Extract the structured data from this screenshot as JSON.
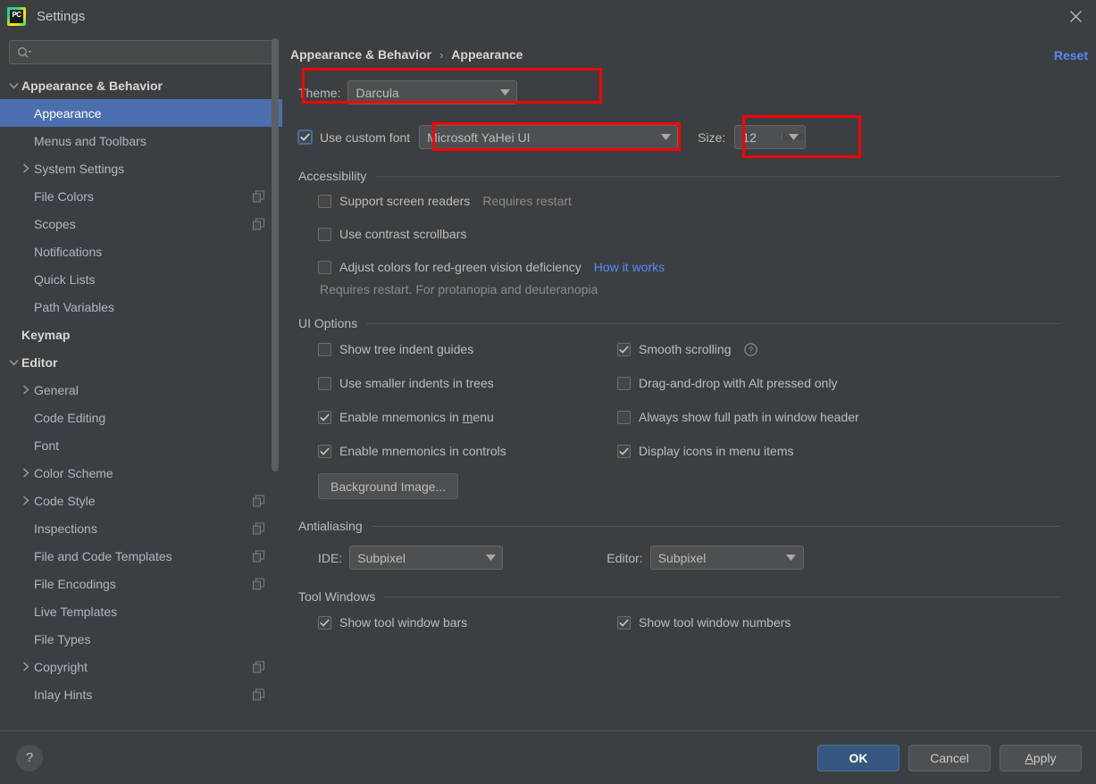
{
  "window": {
    "title": "Settings",
    "logo_text": "PC",
    "logo_icon": "pycharm-logo-icon",
    "close_icon": "close-icon"
  },
  "sidebar": {
    "search": {
      "placeholder": "",
      "value": "",
      "icon": "search-icon"
    },
    "tree": [
      {
        "label": "Appearance & Behavior",
        "level": 0,
        "twisty": "expanded",
        "bold": true,
        "selected": false,
        "badge": false
      },
      {
        "label": "Appearance",
        "level": 1,
        "twisty": "none",
        "bold": false,
        "selected": true,
        "badge": false
      },
      {
        "label": "Menus and Toolbars",
        "level": 1,
        "twisty": "none",
        "bold": false,
        "selected": false,
        "badge": false
      },
      {
        "label": "System Settings",
        "level": 1,
        "twisty": "collapsed",
        "bold": false,
        "selected": false,
        "badge": false
      },
      {
        "label": "File Colors",
        "level": 1,
        "twisty": "none",
        "bold": false,
        "selected": false,
        "badge": true
      },
      {
        "label": "Scopes",
        "level": 1,
        "twisty": "none",
        "bold": false,
        "selected": false,
        "badge": true
      },
      {
        "label": "Notifications",
        "level": 1,
        "twisty": "none",
        "bold": false,
        "selected": false,
        "badge": false
      },
      {
        "label": "Quick Lists",
        "level": 1,
        "twisty": "none",
        "bold": false,
        "selected": false,
        "badge": false
      },
      {
        "label": "Path Variables",
        "level": 1,
        "twisty": "none",
        "bold": false,
        "selected": false,
        "badge": false
      },
      {
        "label": "Keymap",
        "level": 0,
        "twisty": "none",
        "bold": true,
        "selected": false,
        "badge": false
      },
      {
        "label": "Editor",
        "level": 0,
        "twisty": "expanded",
        "bold": true,
        "selected": false,
        "badge": false
      },
      {
        "label": "General",
        "level": 1,
        "twisty": "collapsed",
        "bold": false,
        "selected": false,
        "badge": false
      },
      {
        "label": "Code Editing",
        "level": 1,
        "twisty": "none",
        "bold": false,
        "selected": false,
        "badge": false
      },
      {
        "label": "Font",
        "level": 1,
        "twisty": "none",
        "bold": false,
        "selected": false,
        "badge": false
      },
      {
        "label": "Color Scheme",
        "level": 1,
        "twisty": "collapsed",
        "bold": false,
        "selected": false,
        "badge": false
      },
      {
        "label": "Code Style",
        "level": 1,
        "twisty": "collapsed",
        "bold": false,
        "selected": false,
        "badge": true
      },
      {
        "label": "Inspections",
        "level": 1,
        "twisty": "none",
        "bold": false,
        "selected": false,
        "badge": true
      },
      {
        "label": "File and Code Templates",
        "level": 1,
        "twisty": "none",
        "bold": false,
        "selected": false,
        "badge": true
      },
      {
        "label": "File Encodings",
        "level": 1,
        "twisty": "none",
        "bold": false,
        "selected": false,
        "badge": true
      },
      {
        "label": "Live Templates",
        "level": 1,
        "twisty": "none",
        "bold": false,
        "selected": false,
        "badge": false
      },
      {
        "label": "File Types",
        "level": 1,
        "twisty": "none",
        "bold": false,
        "selected": false,
        "badge": false
      },
      {
        "label": "Copyright",
        "level": 1,
        "twisty": "collapsed",
        "bold": false,
        "selected": false,
        "badge": true
      },
      {
        "label": "Inlay Hints",
        "level": 1,
        "twisty": "none",
        "bold": false,
        "selected": false,
        "badge": true
      }
    ]
  },
  "main": {
    "breadcrumb": {
      "parent": "Appearance & Behavior",
      "separator": "›",
      "current": "Appearance"
    },
    "reset_label": "Reset",
    "theme": {
      "label": "Theme:",
      "value": "Darcula"
    },
    "custom_font": {
      "checkbox_label": "Use custom font",
      "checked": true,
      "font_value": "Microsoft YaHei UI",
      "size_label": "Size:",
      "size_value": "12"
    },
    "accessibility": {
      "title": "Accessibility",
      "options": [
        {
          "label": "Support screen readers",
          "checked": false,
          "hint": "Requires restart",
          "link": ""
        },
        {
          "label": "Use contrast scrollbars",
          "checked": false,
          "hint": "",
          "link": ""
        },
        {
          "label": "Adjust colors for red-green vision deficiency",
          "checked": false,
          "hint": "",
          "link": "How it works"
        }
      ],
      "sub_hint": "Requires restart. For protanopia and deuteranopia"
    },
    "ui_options": {
      "title": "UI Options",
      "left": [
        {
          "label": "Show tree indent guides",
          "checked": false,
          "mnemonic": ""
        },
        {
          "label": "Use smaller indents in trees",
          "checked": false,
          "mnemonic": ""
        },
        {
          "label": "Enable mnemonics in menu",
          "checked": true,
          "mnemonic": "m"
        },
        {
          "label": "Enable mnemonics in controls",
          "checked": true,
          "mnemonic": ""
        }
      ],
      "right": [
        {
          "label": "Smooth scrolling",
          "checked": true,
          "help": true
        },
        {
          "label": "Drag-and-drop with Alt pressed only",
          "checked": false,
          "help": false
        },
        {
          "label": "Always show full path in window header",
          "checked": false,
          "help": false
        },
        {
          "label": "Display icons in menu items",
          "checked": true,
          "help": false
        }
      ],
      "background_image_button": "Background Image..."
    },
    "antialiasing": {
      "title": "Antialiasing",
      "ide_label": "IDE:",
      "ide_value": "Subpixel",
      "editor_label": "Editor:",
      "editor_value": "Subpixel"
    },
    "tool_windows": {
      "title": "Tool Windows",
      "left": {
        "label": "Show tool window bars",
        "checked": true
      },
      "right": {
        "label": "Show tool window numbers",
        "checked": true
      }
    }
  },
  "footer": {
    "help_glyph": "?",
    "ok": "OK",
    "cancel": "Cancel",
    "apply": "Apply",
    "apply_mnemonic": "A"
  },
  "colors": {
    "accent_blue": "#548af7",
    "selection_blue": "#4b6eaf",
    "primary_button": "#365880",
    "annotation_red": "#ff0000",
    "panel_bg": "#3c3f41"
  }
}
